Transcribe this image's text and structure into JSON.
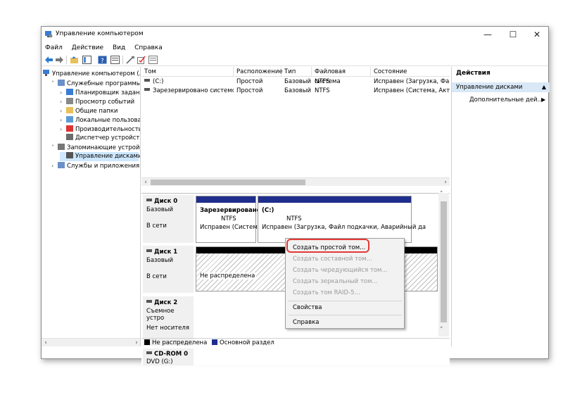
{
  "window": {
    "title": "Управление компьютером"
  },
  "menu": [
    "Файл",
    "Действие",
    "Вид",
    "Справка"
  ],
  "tree": {
    "root": "Управление компьютером (л",
    "nodes": [
      {
        "label": "Служебные программы",
        "indent": 1,
        "exp": "v"
      },
      {
        "label": "Планировщик заданий",
        "indent": 2,
        "exp": ">"
      },
      {
        "label": "Просмотр событий",
        "indent": 2,
        "exp": ">"
      },
      {
        "label": "Общие папки",
        "indent": 2,
        "exp": ">"
      },
      {
        "label": "Локальные пользовате",
        "indent": 2,
        "exp": ">"
      },
      {
        "label": "Производительность",
        "indent": 2,
        "exp": ">"
      },
      {
        "label": "Диспетчер устройств",
        "indent": 2,
        "exp": ""
      },
      {
        "label": "Запоминающие устройств",
        "indent": 1,
        "exp": "v"
      },
      {
        "label": "Управление дисками",
        "indent": 2,
        "exp": "",
        "selected": true
      },
      {
        "label": "Службы и приложения",
        "indent": 1,
        "exp": ">"
      }
    ]
  },
  "volumes": {
    "headers": [
      "Том",
      "Расположение",
      "Тип",
      "Файловая система",
      "Состояние"
    ],
    "rows": [
      [
        "(C:)",
        "Простой",
        "Базовый",
        "NTFS",
        "Исправен (Загрузка, Файл"
      ],
      [
        "Зарезервировано системой",
        "Простой",
        "Базовый",
        "NTFS",
        "Исправен (Система, Активе"
      ]
    ]
  },
  "disks": [
    {
      "name": "Диск 0",
      "type": "Базовый",
      "status": "В сети"
    },
    {
      "name": "Диск 1",
      "type": "Базовый",
      "status": "В сети"
    },
    {
      "name": "Диск 2",
      "type": "Съемное устро",
      "status": "Нет носителя"
    },
    {
      "name": "CD-ROM 0",
      "type": "DVD (G:)",
      "status": ""
    }
  ],
  "partitions": {
    "reserved": {
      "title": "Зарезервировано",
      "fs": "NTFS",
      "status": "Исправен (Систем"
    },
    "c": {
      "title": "(C:)",
      "fs": "NTFS",
      "status": "Исправен (Загрузка, Файл подкачки, Аварийный да"
    },
    "unallocated": {
      "status": "Не распределена"
    }
  },
  "legend": [
    "Не распределена",
    "Основной раздел"
  ],
  "actions": {
    "header": "Действия",
    "section": "Управление дисками",
    "item": "Дополнительные дей..."
  },
  "context_menu": {
    "items": [
      {
        "label": "Создать простой том...",
        "enabled": true
      },
      {
        "label": "Создать составной том...",
        "enabled": false
      },
      {
        "label": "Создать чередующийся том...",
        "enabled": false
      },
      {
        "label": "Создать зеркальный том...",
        "enabled": false
      },
      {
        "label": "Создать том RAID-5...",
        "enabled": false
      },
      {
        "label": "Свойства",
        "enabled": true
      },
      {
        "label": "Справка",
        "enabled": true
      }
    ]
  },
  "colors": {
    "primary_partition": "#1f2e8c",
    "unallocated": "#000000",
    "highlight": "#e53935"
  }
}
